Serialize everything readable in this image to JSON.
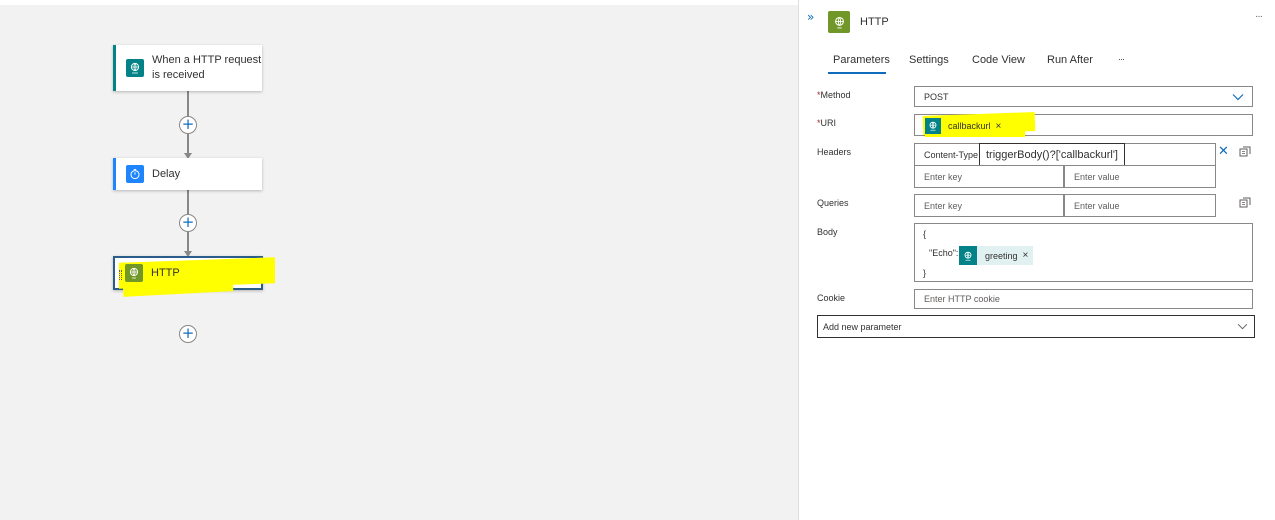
{
  "canvas": {
    "trigger": {
      "label_line1": "When a HTTP request",
      "label_line2": "is received",
      "icon": "http-request-trigger-icon",
      "accent": "#038387"
    },
    "delay": {
      "label": "Delay",
      "icon": "timer-icon",
      "accent": "#1f85ff"
    },
    "http": {
      "label": "HTTP",
      "icon": "http-globe-icon",
      "accent": "#709727"
    },
    "plus_symbol": "+"
  },
  "panel": {
    "expand_icon": "double-chevron-right-icon",
    "title": "HTTP",
    "more_icon": "ellipsis-icon",
    "more_symbol": "···",
    "tabs": [
      {
        "label": "Parameters",
        "selected": true
      },
      {
        "label": "Settings",
        "selected": false
      },
      {
        "label": "Code View",
        "selected": false
      },
      {
        "label": "Run After",
        "selected": false
      }
    ],
    "tabs_more": "···",
    "fields": {
      "required_mark": "*",
      "method_label": "Method",
      "method_value": "POST",
      "uri_label": "URI",
      "uri_token": "callbackurl",
      "headers_label": "Headers",
      "header_key": "Content-Type",
      "header_key_placeholder": "Enter key",
      "header_value_placeholder": "Enter value",
      "queries_label": "Queries",
      "query_key_placeholder": "Enter key",
      "query_value_placeholder": "Enter value",
      "body_label": "Body",
      "body_open": "{",
      "body_key": "\"Echo\":",
      "body_token": "greeting",
      "body_close": "}",
      "cookie_label": "Cookie",
      "cookie_placeholder": "Enter HTTP cookie",
      "add_param_label": "Add new parameter",
      "token_remove_symbol": "×",
      "clear_symbol": "✕"
    },
    "tooltip": "triggerBody()?['callbackurl']"
  },
  "colors": {
    "accent_blue": "#0f6cbd",
    "highlight": "#ffff00",
    "http_green": "#709727",
    "trigger_teal": "#038387"
  }
}
